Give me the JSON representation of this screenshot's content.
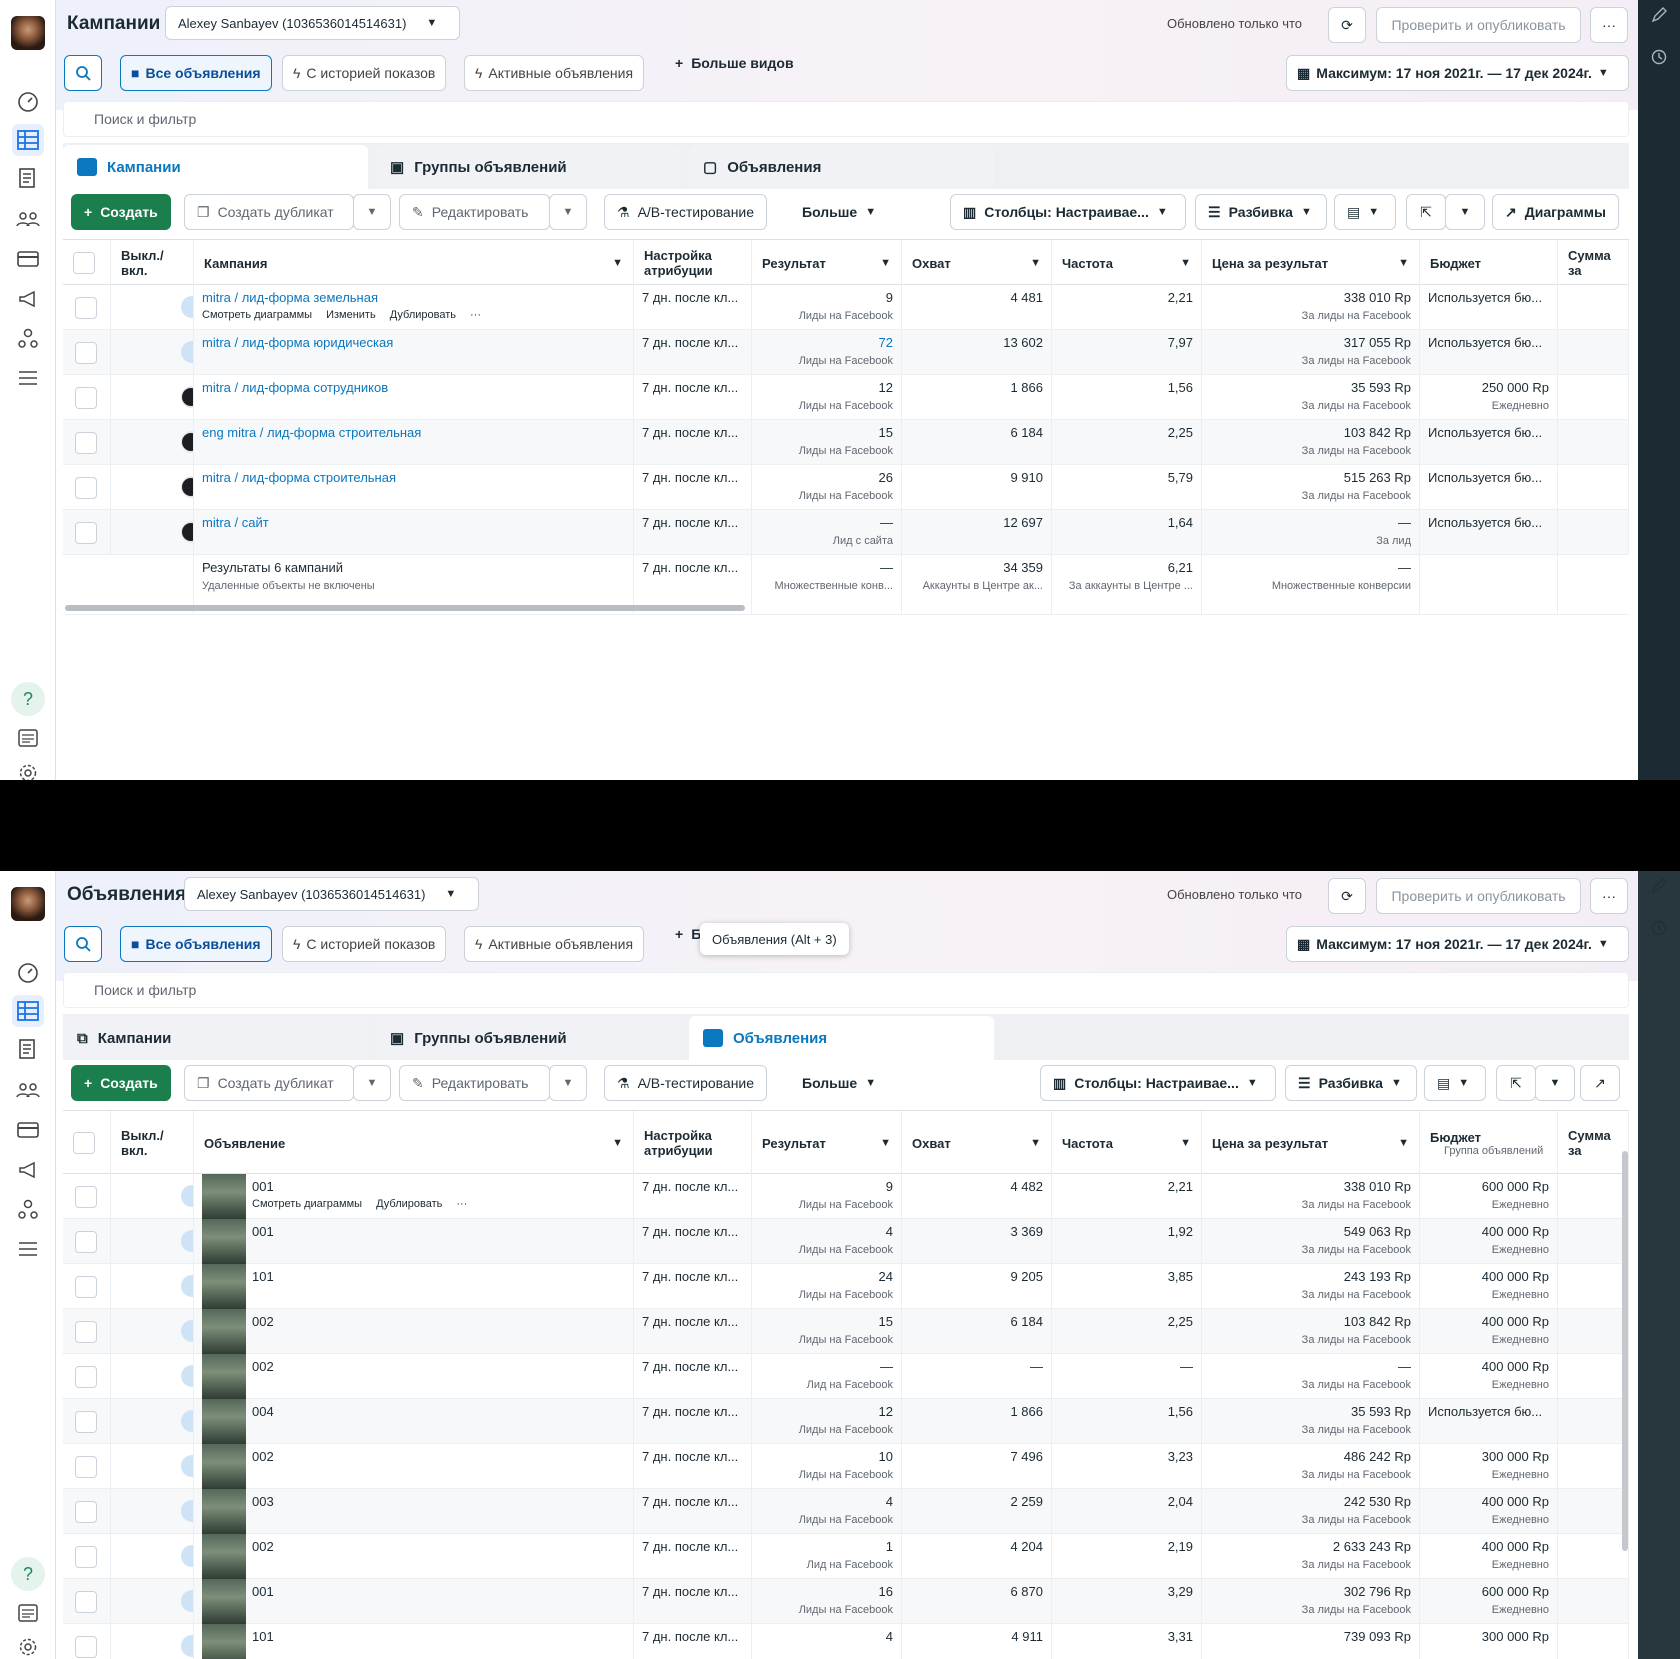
{
  "shared": {
    "account": "Alexey Sanbayev (1036536014514631)",
    "updated": "Обновлено только что",
    "publish": "Проверить и опубликовать",
    "views": [
      "Все объявления",
      "С историей показов",
      "Активные объявления"
    ],
    "more_views": "Больше видов",
    "date_range": "Максимум: 17 ноя 2021г. — 17 дек 2024г.",
    "search_placeholder": "Поиск и фильтр",
    "tabs": [
      "Кампании",
      "Группы объявлений",
      "Объявления"
    ],
    "toolbar": {
      "create": "Создать",
      "duplicate": "Создать дубликат",
      "edit": "Редактировать",
      "ab": "A/B-тестирование",
      "more": "Больше",
      "columns": "Столбцы: Настраивае...",
      "breakdown": "Разбивка",
      "charts": "Диаграммы"
    },
    "headers": {
      "toggle": "Выкл./ вкл.",
      "attribution": "Настройка атрибуции",
      "result": "Результат",
      "reach": "Охват",
      "frequency": "Частота",
      "cost": "Цена за результат",
      "budget": "Бюджет",
      "spent": "Сумма за"
    }
  },
  "top": {
    "title": "Кампании",
    "name_header": "Кампания",
    "row_actions": [
      "Смотреть диаграммы",
      "Изменить",
      "Дублировать"
    ],
    "rows": [
      {
        "name": "mitra / лид-форма земельная",
        "on": true,
        "attribution": "7 дн. после кл...",
        "result": "9",
        "result_sub": "Лиды на Facebook",
        "reach": "4 481",
        "freq": "2,21",
        "cost": "338 010 Rp",
        "cost_sub": "За лиды на Facebook",
        "budget": "Используется бю...",
        "budget_sub": ""
      },
      {
        "name": "mitra / лид-форма юридическая",
        "on": true,
        "attribution": "7 дн. после кл...",
        "result": "72",
        "result_sub": "Лиды на Facebook",
        "reach": "13 602",
        "freq": "7,97",
        "cost": "317 055 Rp",
        "cost_sub": "За лиды на Facebook",
        "budget": "Используется бю...",
        "budget_sub": ""
      },
      {
        "name": "mitra / лид-форма сотрудников",
        "on": false,
        "attribution": "7 дн. после кл...",
        "result": "12",
        "result_sub": "Лиды на Facebook",
        "reach": "1 866",
        "freq": "1,56",
        "cost": "35 593 Rp",
        "cost_sub": "За лиды на Facebook",
        "budget": "250 000 Rp",
        "budget_sub": "Ежедневно"
      },
      {
        "name": "eng mitra / лид-форма строительная",
        "on": false,
        "attribution": "7 дн. после кл...",
        "result": "15",
        "result_sub": "Лиды на Facebook",
        "reach": "6 184",
        "freq": "2,25",
        "cost": "103 842 Rp",
        "cost_sub": "За лиды на Facebook",
        "budget": "Используется бю...",
        "budget_sub": ""
      },
      {
        "name": "mitra / лид-форма строительная",
        "on": false,
        "attribution": "7 дн. после кл...",
        "result": "26",
        "result_sub": "Лиды на Facebook",
        "reach": "9 910",
        "freq": "5,79",
        "cost": "515 263 Rp",
        "cost_sub": "За лиды на Facebook",
        "budget": "Используется бю...",
        "budget_sub": ""
      },
      {
        "name": "mitra / сайт",
        "on": false,
        "attribution": "7 дн. после кл...",
        "result": "—",
        "result_sub": "Лид с сайта",
        "reach": "12 697",
        "freq": "1,64",
        "cost": "—",
        "cost_sub": "За лид",
        "budget": "Используется бю...",
        "budget_sub": ""
      }
    ],
    "totals": {
      "label": "Результаты 6 кампаний",
      "sub": "Удаленные объекты не включены",
      "attribution": "7 дн. после кл...",
      "result": "—",
      "result_sub": "Множественные конв...",
      "reach": "34 359",
      "reach_sub": "Аккаунты в Центре ак...",
      "freq": "6,21",
      "freq_sub": "За аккаунты в Центре ...",
      "cost": "—",
      "cost_sub": "Множественные конверсии"
    }
  },
  "bottom": {
    "title": "Объявления",
    "tooltip": "Объявления (Alt + 3)",
    "name_header": "Объявление",
    "budget_sub_header": "Группа объявлений",
    "row_actions": [
      "Смотреть диаграммы",
      "Дублировать"
    ],
    "rows": [
      {
        "name": "001",
        "attribution": "7 дн. после кл...",
        "result": "9",
        "result_sub": "Лиды на Facebook",
        "reach": "4 482",
        "freq": "2,21",
        "cost": "338 010 Rp",
        "cost_sub": "За лиды на Facebook",
        "budget": "600 000 Rp",
        "budget_sub": "Ежедневно"
      },
      {
        "name": "001",
        "attribution": "7 дн. после кл...",
        "result": "4",
        "result_sub": "Лиды на Facebook",
        "reach": "3 369",
        "freq": "1,92",
        "cost": "549 063 Rp",
        "cost_sub": "За лиды на Facebook",
        "budget": "400 000 Rp",
        "budget_sub": "Ежедневно"
      },
      {
        "name": "101",
        "attribution": "7 дн. после кл...",
        "result": "24",
        "result_sub": "Лиды на Facebook",
        "reach": "9 205",
        "freq": "3,85",
        "cost": "243 193 Rp",
        "cost_sub": "За лиды на Facebook",
        "budget": "400 000 Rp",
        "budget_sub": "Ежедневно"
      },
      {
        "name": "002",
        "attribution": "7 дн. после кл...",
        "result": "15",
        "result_sub": "Лиды на Facebook",
        "reach": "6 184",
        "freq": "2,25",
        "cost": "103 842 Rp",
        "cost_sub": "За лиды на Facebook",
        "budget": "400 000 Rp",
        "budget_sub": "Ежедневно"
      },
      {
        "name": "002",
        "attribution": "7 дн. после кл...",
        "result": "—",
        "result_sub": "Лид на Facebook",
        "reach": "—",
        "freq": "—",
        "cost": "—",
        "cost_sub": "За лиды на Facebook",
        "budget": "400 000 Rp",
        "budget_sub": "Ежедневно"
      },
      {
        "name": "004",
        "attribution": "7 дн. после кл...",
        "result": "12",
        "result_sub": "Лиды на Facebook",
        "reach": "1 866",
        "freq": "1,56",
        "cost": "35 593 Rp",
        "cost_sub": "За лиды на Facebook",
        "budget": "Используется бю...",
        "budget_sub": ""
      },
      {
        "name": "002",
        "attribution": "7 дн. после кл...",
        "result": "10",
        "result_sub": "Лиды на Facebook",
        "reach": "7 496",
        "freq": "3,23",
        "cost": "486 242 Rp",
        "cost_sub": "За лиды на Facebook",
        "budget": "300 000 Rp",
        "budget_sub": "Ежедневно"
      },
      {
        "name": "003",
        "attribution": "7 дн. после кл...",
        "result": "4",
        "result_sub": "Лиды на Facebook",
        "reach": "2 259",
        "freq": "2,04",
        "cost": "242 530 Rp",
        "cost_sub": "За лиды на Facebook",
        "budget": "400 000 Rp",
        "budget_sub": "Ежедневно"
      },
      {
        "name": "002",
        "attribution": "7 дн. после кл...",
        "result": "1",
        "result_sub": "Лид на Facebook",
        "reach": "4 204",
        "freq": "2,19",
        "cost": "2 633 243 Rp",
        "cost_sub": "За лиды на Facebook",
        "budget": "400 000 Rp",
        "budget_sub": "Ежедневно"
      },
      {
        "name": "001",
        "attribution": "7 дн. после кл...",
        "result": "16",
        "result_sub": "Лиды на Facebook",
        "reach": "6 870",
        "freq": "3,29",
        "cost": "302 796 Rp",
        "cost_sub": "За лиды на Facebook",
        "budget": "600 000 Rp",
        "budget_sub": "Ежедневно"
      },
      {
        "name": "101",
        "attribution": "7 дн. после кл...",
        "result": "4",
        "result_sub": "",
        "reach": "4 911",
        "freq": "3,31",
        "cost": "739 093 Rp",
        "cost_sub": "",
        "budget": "300 000 Rp",
        "budget_sub": ""
      }
    ]
  },
  "colors": {
    "accent": "#0a78be",
    "create": "#1b7f4d",
    "toggle_on": "#1a73e8"
  }
}
